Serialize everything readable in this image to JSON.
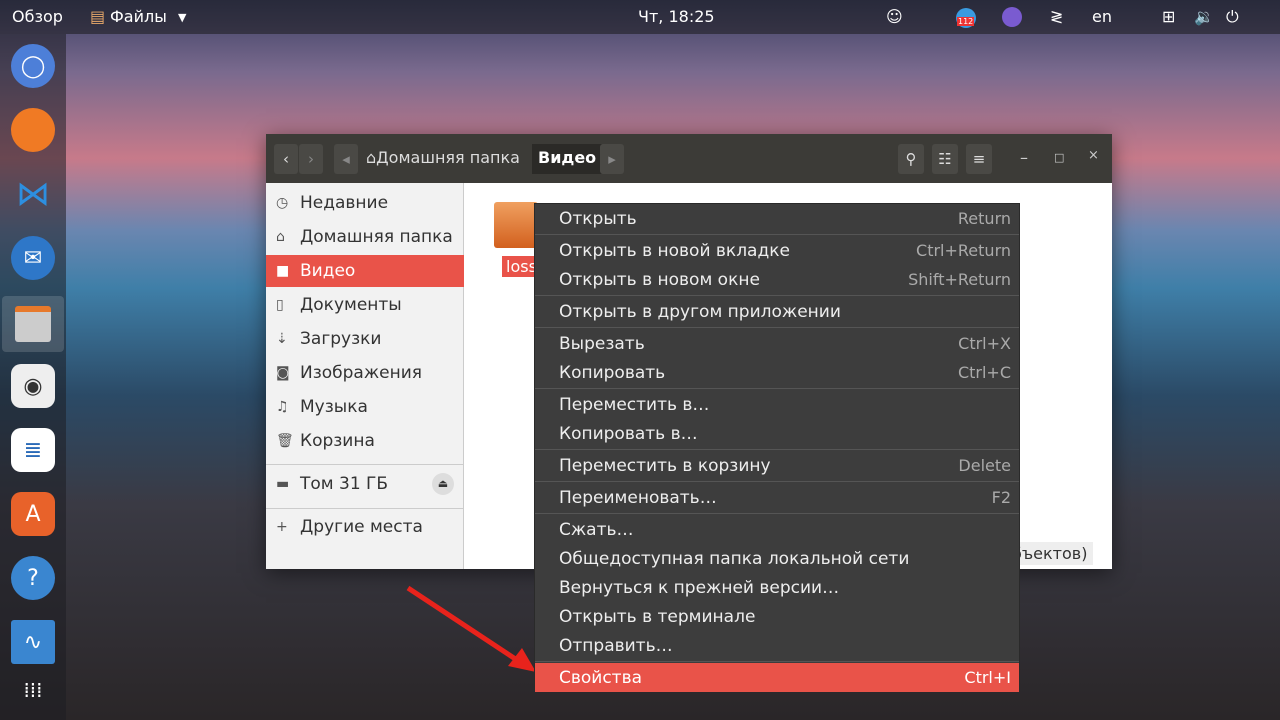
{
  "topbar": {
    "overview": "Обзор",
    "app": "Файлы",
    "clock": "Чт, 18:25",
    "telegram_badge": "112",
    "lang": "en"
  },
  "dock": [
    "chromium",
    "firefox",
    "vscode",
    "thunderbird",
    "files",
    "rhythmbox",
    "writer",
    "software",
    "help",
    "monitor",
    "apps-grid"
  ],
  "window": {
    "breadcrumb": {
      "home": "Домашняя папка",
      "current": "Видео"
    },
    "sidebar": [
      {
        "icon": "◷",
        "label": "Недавние"
      },
      {
        "icon": "⌂",
        "label": "Домашняя папка"
      },
      {
        "icon": "■",
        "label": "Видео",
        "active": true
      },
      {
        "icon": "▯",
        "label": "Документы"
      },
      {
        "icon": "⇣",
        "label": "Загрузки"
      },
      {
        "icon": "◙",
        "label": "Изображения"
      },
      {
        "icon": "♫",
        "label": "Музыка"
      },
      {
        "icon": "🗑",
        "label": "Корзина"
      }
    ],
    "volume": "Том 31 ГБ",
    "other": "Другие места",
    "file_name": "loss",
    "status": "бъектов)"
  },
  "menu": [
    {
      "label": "Открыть",
      "key": "Return"
    },
    {
      "sep": true
    },
    {
      "label": "Открыть в новой вкладке",
      "key": "Ctrl+Return"
    },
    {
      "label": "Открыть в новом окне",
      "key": "Shift+Return"
    },
    {
      "sep": true
    },
    {
      "label": "Открыть в другом приложении",
      "key": ""
    },
    {
      "sep": true
    },
    {
      "label": "Вырезать",
      "key": "Ctrl+X"
    },
    {
      "label": "Копировать",
      "key": "Ctrl+C"
    },
    {
      "sep": true
    },
    {
      "label": "Переместить в…",
      "key": ""
    },
    {
      "label": "Копировать в…",
      "key": ""
    },
    {
      "sep": true
    },
    {
      "label": "Переместить в корзину",
      "key": "Delete"
    },
    {
      "sep": true
    },
    {
      "label": "Переименовать…",
      "key": "F2"
    },
    {
      "sep": true
    },
    {
      "label": "Сжать…",
      "key": ""
    },
    {
      "label": "Общедоступная папка локальной сети",
      "key": ""
    },
    {
      "label": "Вернуться к прежней версии…",
      "key": ""
    },
    {
      "label": "Открыть в терминале",
      "key": ""
    },
    {
      "label": "Отправить…",
      "key": ""
    },
    {
      "sep": true
    },
    {
      "label": "Свойства",
      "key": "Ctrl+I",
      "active": true
    }
  ]
}
